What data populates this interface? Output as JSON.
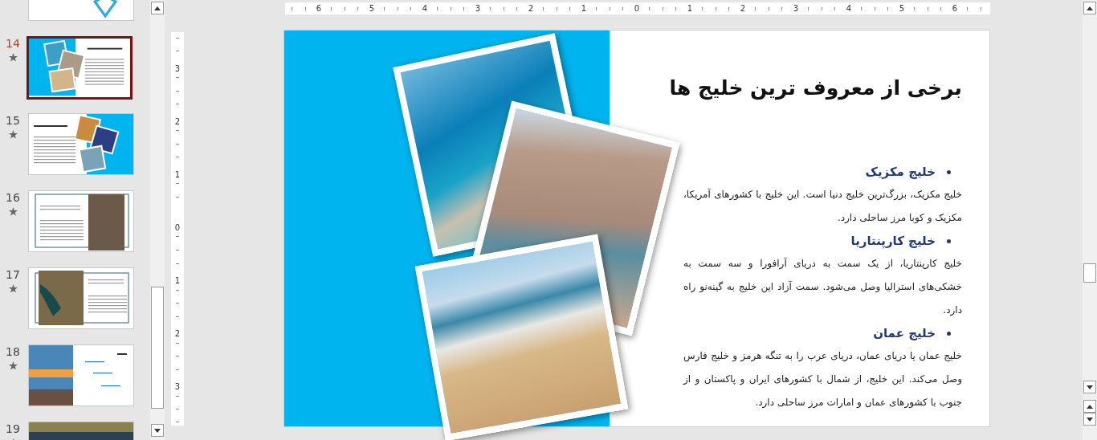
{
  "slides_panel": {
    "slides": [
      {
        "kind": "diamond",
        "selected": false
      },
      {
        "number": "14",
        "kind": "photos-left",
        "selected": true
      },
      {
        "number": "15",
        "kind": "photos-right",
        "selected": false
      },
      {
        "number": "16",
        "kind": "framed-photo-right",
        "selected": false
      },
      {
        "number": "17",
        "kind": "framed-photo-left",
        "selected": false
      },
      {
        "number": "18",
        "kind": "photo-list",
        "selected": false
      },
      {
        "number": "19",
        "kind": "banner",
        "selected": false
      }
    ]
  },
  "rulers": {
    "horizontal": [
      "6",
      "5",
      "4",
      "3",
      "2",
      "1",
      "0",
      "1",
      "2",
      "3",
      "4",
      "5",
      "6"
    ],
    "vertical": [
      "3",
      "2",
      "1",
      "0",
      "1",
      "2",
      "3"
    ]
  },
  "slide": {
    "title": "برخی از معروف ترین خلیج ها",
    "sections": [
      {
        "heading": "خلیج مکزیک",
        "body": "خلیج مکزیک، بزرگ‌ترین خلیج دنیا است. این خلیج با کشورهای آمریکا، مکزیک و کوبا مرز ساحلی دارد."
      },
      {
        "heading": "خلیج کارپنتاریا",
        "body": "خلیج کارپنتاریا، از یک سمت به دریای آرافورا و سه سمت به خشکی‌های استرالیا وصل می‌شود. سمت آزاد این خلیج به گینه‌نو راه دارد."
      },
      {
        "heading": "خلیج عمان",
        "body": "خلیج عمان یا دریای عمان، دریای عرب را به تنگه هرمز و خلیج فارس وصل می‌کند. این خلیج، از شمال با کشورهای ایران و پاکستان و از جنوب با کشورهای عمان و امارات مرز ساحلی دارد."
      }
    ]
  }
}
